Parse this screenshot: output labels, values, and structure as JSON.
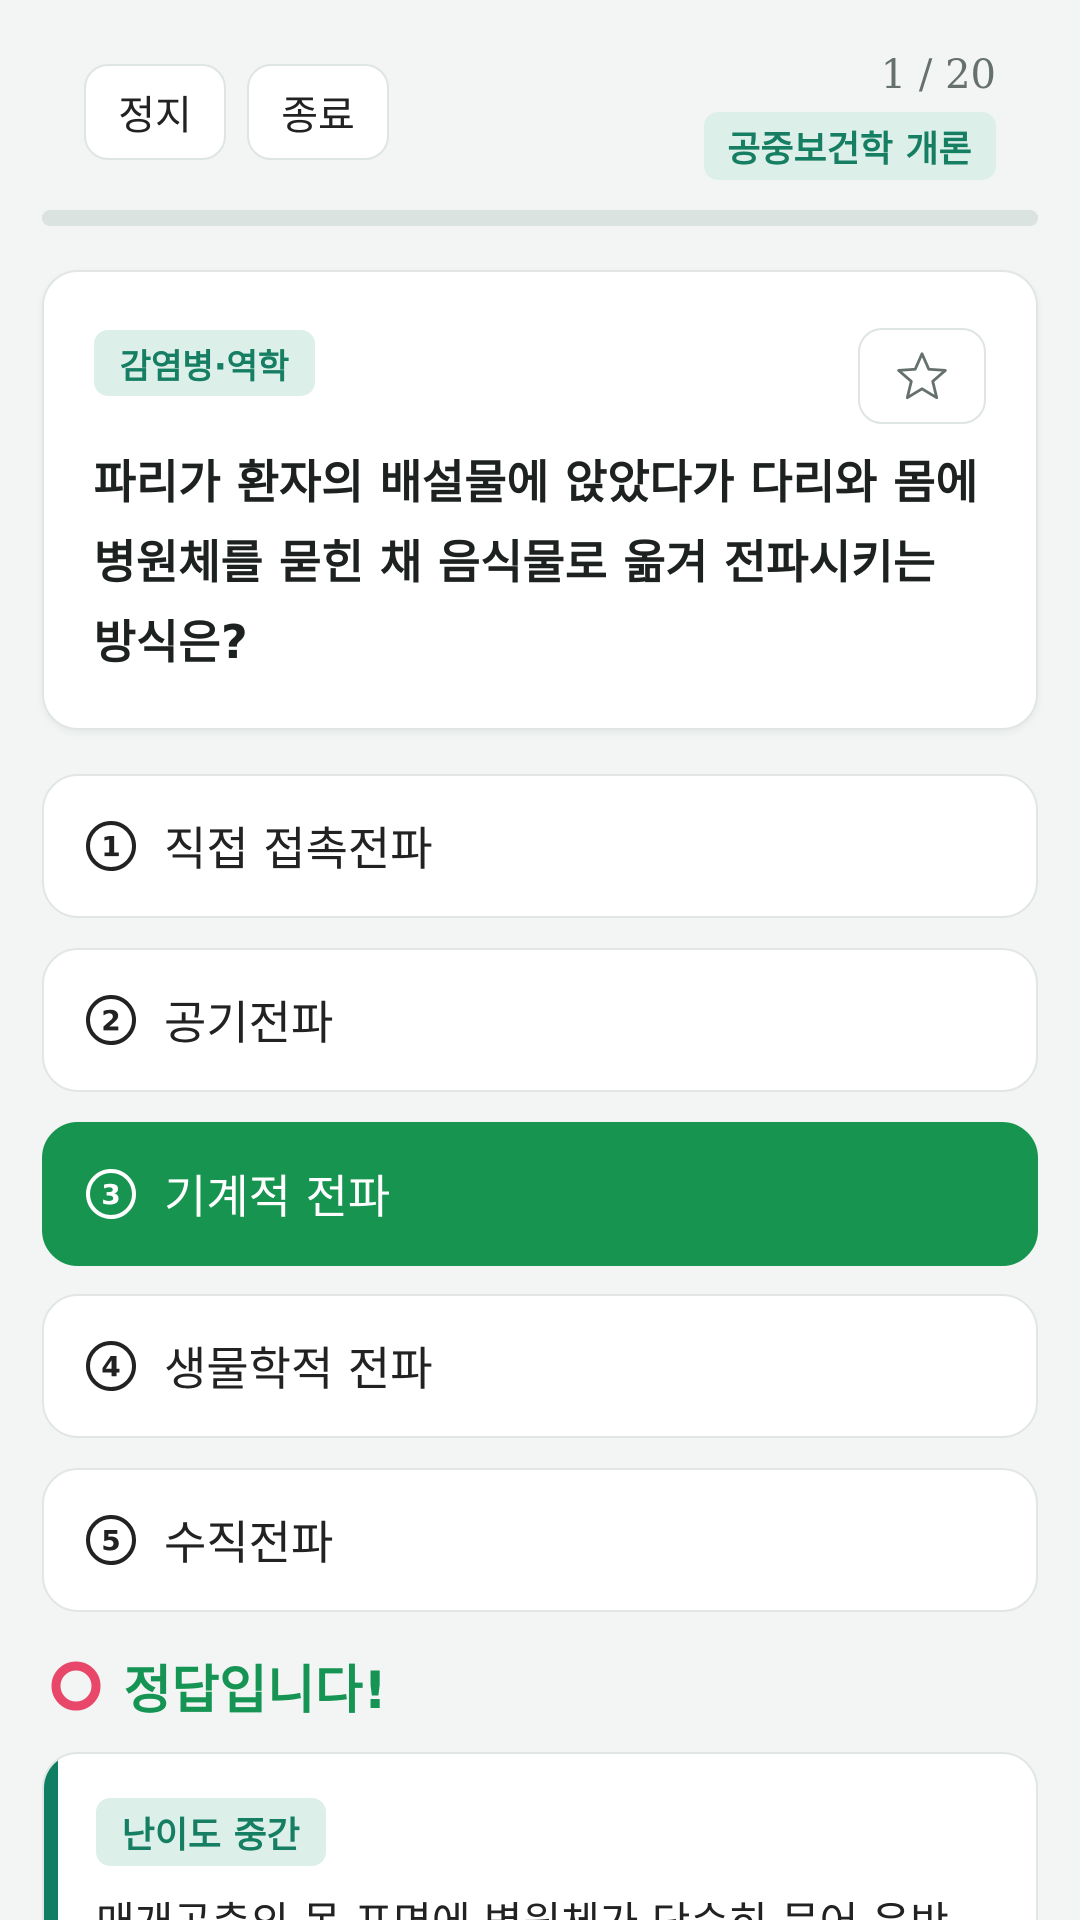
{
  "toolbar": {
    "pause_label": "정지",
    "end_label": "종료",
    "counter": "1 / 20",
    "subject": "공중보건학 개론"
  },
  "progress": {
    "current": 1,
    "total": 20
  },
  "question": {
    "category": "감염병·역학",
    "favorite_icon": "star-outline-icon",
    "text": "파리가 환자의 배설물에 앉았다가 다리와 몸에 병원체를 묻힌 채 음식물로 옮겨 전파시키는 방식은?"
  },
  "options": [
    {
      "num": "1",
      "label": "직접 접촉전파",
      "selected": false
    },
    {
      "num": "2",
      "label": "공기전파",
      "selected": false
    },
    {
      "num": "3",
      "label": "기계적 전파",
      "selected": true
    },
    {
      "num": "4",
      "label": "생물학적 전파",
      "selected": false
    },
    {
      "num": "5",
      "label": "수직전파",
      "selected": false
    }
  ],
  "result": {
    "icon": "correct-circle-icon",
    "text": "정답입니다!"
  },
  "explanation": {
    "level": "난이도 중간",
    "text": "매개곤충의 몸 표면에 병원체가 단순히 묻어 운반"
  },
  "colors": {
    "accent": "#169454",
    "badge_bg": "#dcefe8",
    "badge_text": "#167e63",
    "correct_ring": "#e8476a"
  }
}
